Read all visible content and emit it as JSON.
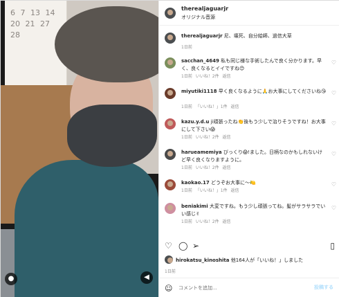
{
  "post": {
    "username": "therealjaguarjr",
    "audio": "オリジナル音源",
    "caption_user": "therealjaguarjr",
    "caption": "尼、壊死、自分給師、過信大草",
    "caption_time": "1日前"
  },
  "comments": [
    {
      "user": "sacchan_4649",
      "text": "私も同じ様な手術したんで良く分かります。早く、良くなるとイイですね😊",
      "time": "1日前",
      "likes": "いいね！2件",
      "reply": "返信"
    },
    {
      "user": "miyutiki1118",
      "text": "早く良くなるように🙏お大事にしてくださいね😘",
      "time": "1日前",
      "likes": "「いいね！」1件",
      "reply": "返信"
    },
    {
      "user": "kazu.y.d.u",
      "text": "ji頑張ったね👏後もう少しで治りそうですね！お大事にして下さい😱",
      "time": "1日前",
      "likes": "いいね！2件",
      "reply": "返信"
    },
    {
      "user": "harueamemiya",
      "text": "びっくり😱!ました。日柄なのかもしれないけど早く良くなりますように。",
      "time": "1日前",
      "likes": "いいね！2件",
      "reply": "返信"
    },
    {
      "user": "kaokao.17",
      "text": "どうぞお大事に〜🍋",
      "time": "1日前",
      "likes": "「いいね！」1件",
      "reply": "返信"
    },
    {
      "user": "beniakimi",
      "text": "大変ですね。もう少し頑張ってね。髪がサラサラでいい感じ✌",
      "time": "1日前",
      "likes": "いいね！2件",
      "reply": "返信"
    }
  ],
  "likes_line": {
    "user": "hirokatsu_kinoshita",
    "text": "他164人が「いいね！」しました"
  },
  "post_date": "1日前",
  "composer": {
    "placeholder": "コメントを追加...",
    "post_label": "投稿する"
  },
  "calendar_text": "6 7 13 14 20 21 27 28",
  "icons": {
    "heart": "heart-icon",
    "comment": "comment-icon",
    "share": "share-icon",
    "save": "bookmark-icon",
    "emoji": "emoji-icon"
  }
}
